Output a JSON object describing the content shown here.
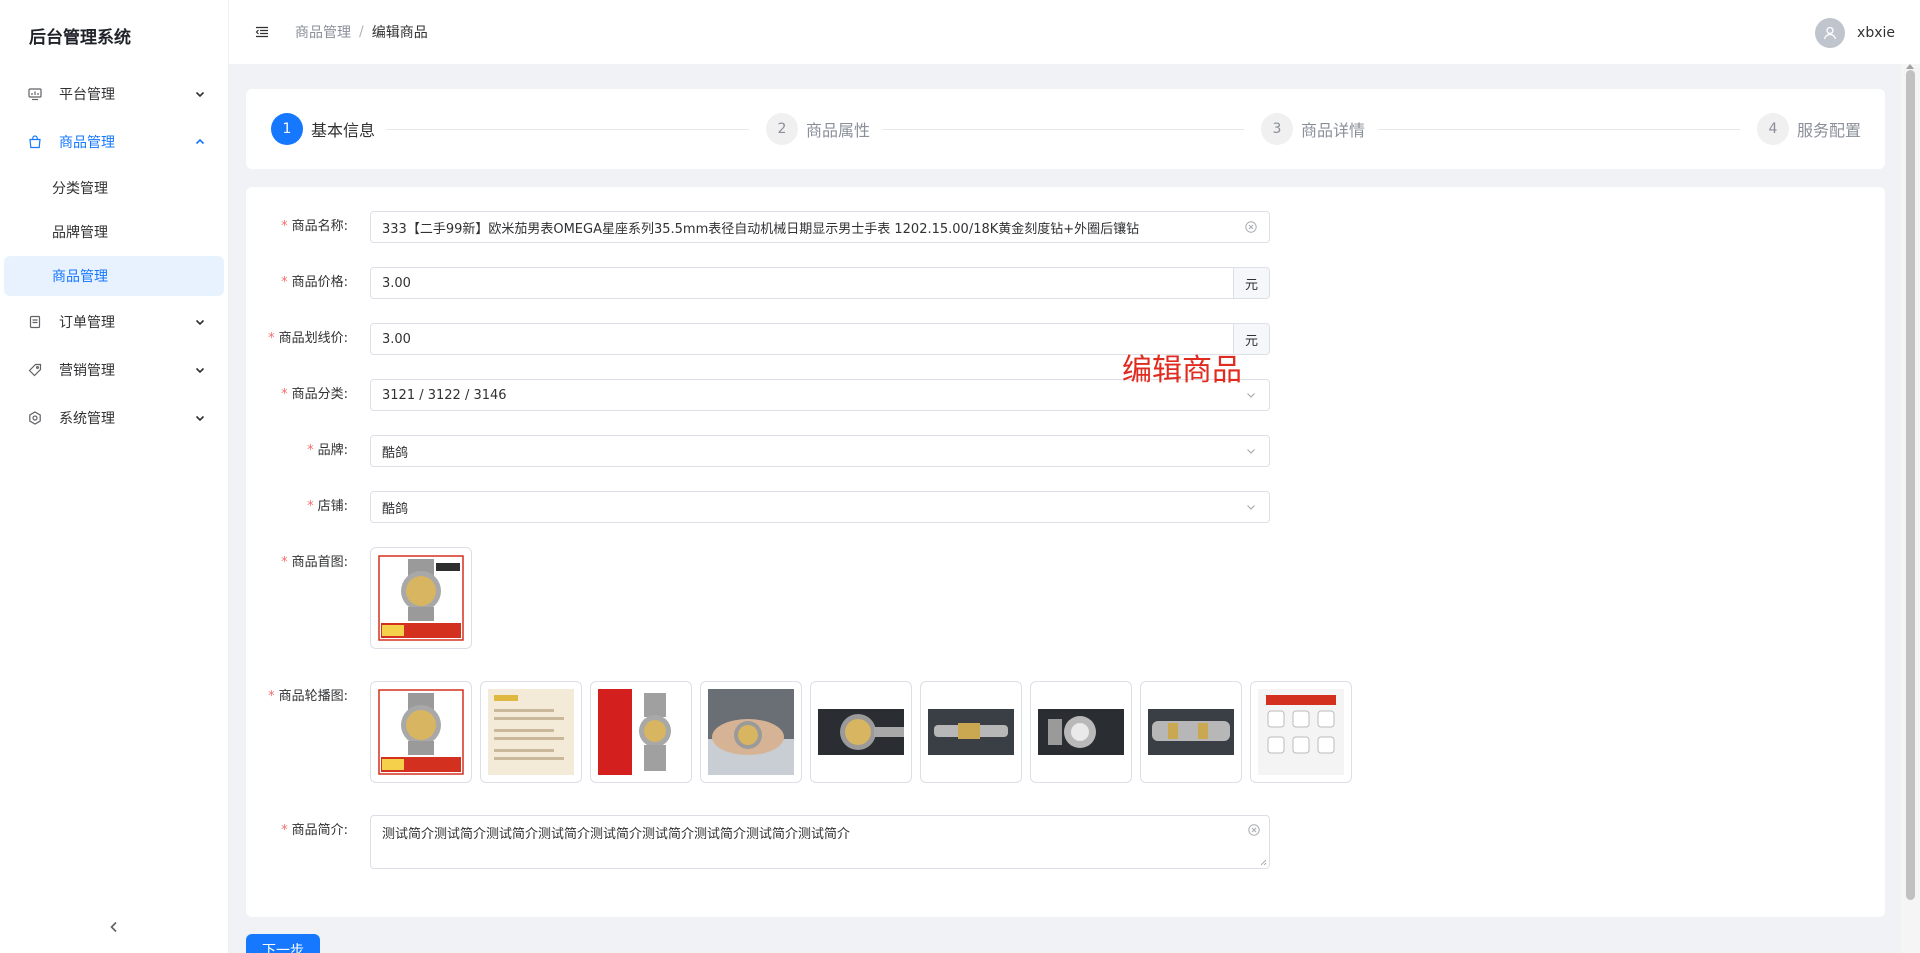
{
  "app": {
    "title": "后台管理系统"
  },
  "sidebar": {
    "items": [
      {
        "label": "平台管理",
        "icon": "monitor-icon",
        "expanded": false
      },
      {
        "label": "商品管理",
        "icon": "bag-icon",
        "expanded": true,
        "children": [
          {
            "label": "分类管理"
          },
          {
            "label": "品牌管理"
          },
          {
            "label": "商品管理",
            "active": true
          }
        ]
      },
      {
        "label": "订单管理",
        "icon": "document-icon",
        "expanded": false
      },
      {
        "label": "营销管理",
        "icon": "tag-icon",
        "expanded": false
      },
      {
        "label": "系统管理",
        "icon": "settings-icon",
        "expanded": false
      }
    ]
  },
  "header": {
    "breadcrumb": {
      "parent": "商品管理",
      "separator": "/",
      "current": "编辑商品"
    },
    "user": {
      "name": "xbxie"
    }
  },
  "steps": [
    {
      "num": "1",
      "label": "基本信息",
      "active": true
    },
    {
      "num": "2",
      "label": "商品属性",
      "active": false
    },
    {
      "num": "3",
      "label": "商品详情",
      "active": false
    },
    {
      "num": "4",
      "label": "服务配置",
      "active": false
    }
  ],
  "form": {
    "name": {
      "label": "商品名称:",
      "value": "333【二手99新】欧米茄男表OMEGA星座系列35.5mm表径自动机械日期显示男士手表 1202.15.00/18K黄金刻度钻+外圈后镶钻"
    },
    "price": {
      "label": "商品价格:",
      "value": "3.00",
      "unit": "元"
    },
    "original_price": {
      "label": "商品划线价:",
      "value": "3.00",
      "unit": "元"
    },
    "category": {
      "label": "商品分类:",
      "value": "3121 / 3122 / 3146"
    },
    "brand": {
      "label": "品牌:",
      "value": "酷鸽"
    },
    "shop": {
      "label": "店铺:",
      "value": "酷鸽"
    },
    "main_image": {
      "label": "商品首图:"
    },
    "carousel": {
      "label": "商品轮播图:",
      "count": 9
    },
    "intro": {
      "label": "商品简介:",
      "value": "测试简介测试简介测试简介测试简介测试简介测试简介测试简介测试简介测试简介"
    }
  },
  "watermark": "编辑商品",
  "actions": {
    "next_label": "下一步"
  },
  "colors": {
    "primary": "#1677ff",
    "required": "#f56c6c",
    "watermark": "#e02b20"
  }
}
